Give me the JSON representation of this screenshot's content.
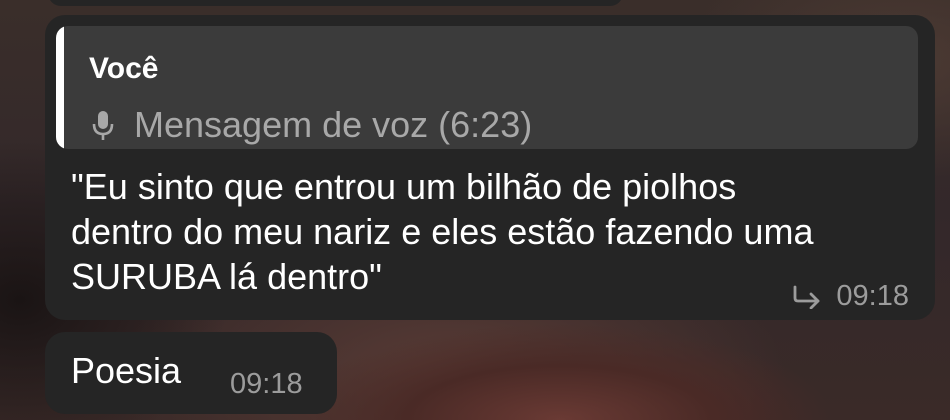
{
  "messages": [
    {
      "reply": {
        "author": "Você",
        "icon": "microphone-icon",
        "snippet": "Mensagem de voz (6:23)"
      },
      "text": "\"Eu sinto que entrou um bilhão de piolhos\ndentro do meu nariz e eles estão fazendo uma\nSURUBA lá dentro\"",
      "status_icon": "forward-arrow-icon",
      "time": "09:18"
    },
    {
      "text": "Poesia",
      "time": "09:18"
    }
  ],
  "colors": {
    "bubble_background": "#252525",
    "quote_background": "#3b3b3b",
    "quote_bar": "#ffffff",
    "text": "#ffffff",
    "muted_text": "#9c9c9c"
  }
}
